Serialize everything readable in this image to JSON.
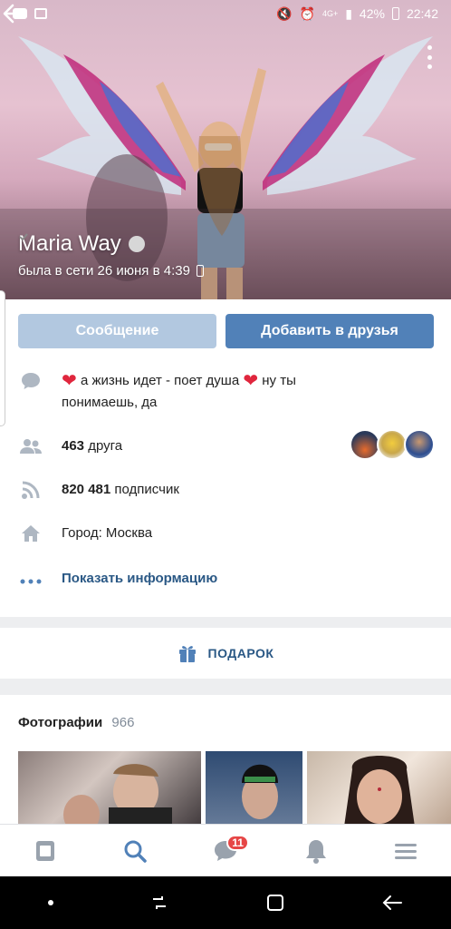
{
  "status_bar": {
    "battery": "42%",
    "time": "22:42",
    "network": "4G+"
  },
  "profile": {
    "name": "Maria Way",
    "last_seen": "была в сети 26 июня в 4:39"
  },
  "actions": {
    "message_label": "Сообщение",
    "add_friend_label": "Добавить в друзья"
  },
  "info": {
    "status_part1": "а жизнь идет - поет душа",
    "status_part2": "ну ты понимаешь, да",
    "friends_count": "463",
    "friends_word": "друга",
    "followers_count": "820 481",
    "followers_word": "подписчик",
    "city": "Город: Москва",
    "show_info": "Показать информацию"
  },
  "gift": {
    "label": "ПОДАРОК"
  },
  "photos": {
    "title": "Фотографии",
    "count": "966"
  },
  "bottom_nav": {
    "messages_badge": "11"
  },
  "colors": {
    "accent": "#5181b8",
    "link": "#2a5885",
    "badge": "#e64646",
    "secondary_button": "#b2c8e0"
  },
  "icons": [
    "back-icon",
    "more-icon",
    "verified-icon",
    "comment-icon",
    "friends-icon",
    "rss-icon",
    "home-icon",
    "dots-icon",
    "gift-icon",
    "news-icon",
    "search-icon",
    "messages-icon",
    "bell-icon",
    "menu-icon"
  ]
}
